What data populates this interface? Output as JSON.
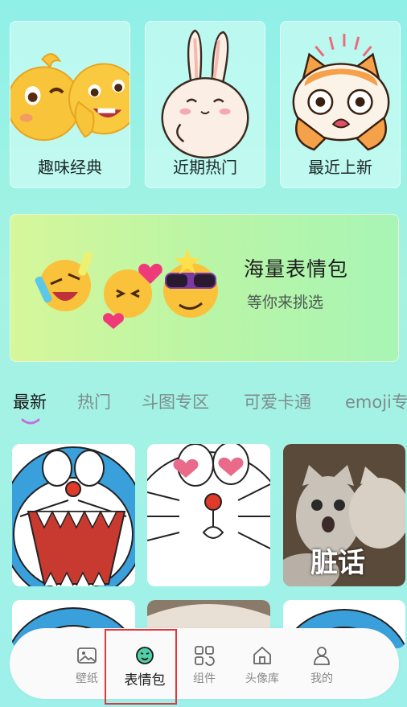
{
  "categories": [
    {
      "label": "趣味经典",
      "icon": "laughing-emoji-pair"
    },
    {
      "label": "近期热门",
      "icon": "bunny-sticker"
    },
    {
      "label": "最近上新",
      "icon": "surprised-cat-sticker"
    }
  ],
  "banner": {
    "title": "海量表情包",
    "subtitle": "等你来挑选",
    "icon": "emoji-group"
  },
  "tabs": [
    "最新",
    "热门",
    "斗图专区",
    "可爱卡通",
    "emoji专"
  ],
  "active_tab": "最新",
  "grid": {
    "row1": [
      {
        "icon": "doraemon-shouting-sticker"
      },
      {
        "icon": "doraemon-heart-eyes-sticker"
      },
      {
        "icon": "cats-sticker",
        "caption": "脏话"
      }
    ],
    "row2": [
      {
        "icon": "doraemon-sticker-partial"
      },
      {
        "icon": "photo-sticker-partial"
      },
      {
        "icon": "doraemon-sticker-partial"
      }
    ]
  },
  "nav": [
    {
      "label": "壁纸",
      "icon": "image-icon"
    },
    {
      "label": "表情包",
      "icon": "emoji-face-icon"
    },
    {
      "label": "组件",
      "icon": "widgets-icon"
    },
    {
      "label": "头像库",
      "icon": "home-icon"
    },
    {
      "label": "我的",
      "icon": "person-icon"
    }
  ],
  "active_nav": "表情包",
  "colors": {
    "accent_underline": "#c86de0",
    "highlight_box": "#e0373c",
    "banner_start": "#d6f79a",
    "banner_end": "#a8f5b5"
  }
}
